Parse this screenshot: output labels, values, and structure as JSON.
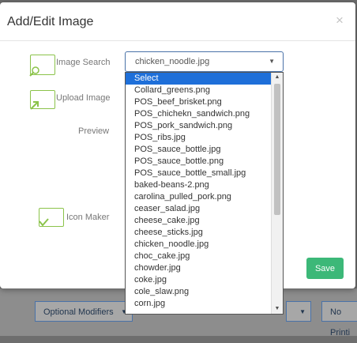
{
  "modal": {
    "title": "Add/Edit Image",
    "close": "×",
    "save_label": "Save"
  },
  "labels": {
    "image_search": "Image Search",
    "upload_image": "Upload Image",
    "preview": "Preview",
    "icon_maker": "Icon Maker"
  },
  "image_select": {
    "value": "chicken_noodle.jpg",
    "options": [
      "Select",
      "Collard_greens.png",
      "POS_beef_brisket.png",
      "POS_chichekn_sandwich.png",
      "POS_pork_sandwich.png",
      "POS_ribs.jpg",
      "POS_sauce_bottle.jpg",
      "POS_sauce_bottle.png",
      "POS_sauce_bottle_small.jpg",
      "baked-beans-2.png",
      "carolina_pulled_pork.png",
      "ceaser_salad.jpg",
      "cheese_cake.jpg",
      "cheese_sticks.jpg",
      "chicken_noodle.jpg",
      "choc_cake.jpg",
      "chowder.jpg",
      "coke.jpg",
      "cole_slaw.png",
      "corn.jpg"
    ],
    "highlighted": "Select"
  },
  "background": {
    "optional_modifiers": "Optional Modifiers",
    "no_print": "No Printi"
  },
  "colors": {
    "accent_green": "#8bc34a",
    "save_green": "#3cb878",
    "highlight_blue": "#1e6fd9"
  }
}
